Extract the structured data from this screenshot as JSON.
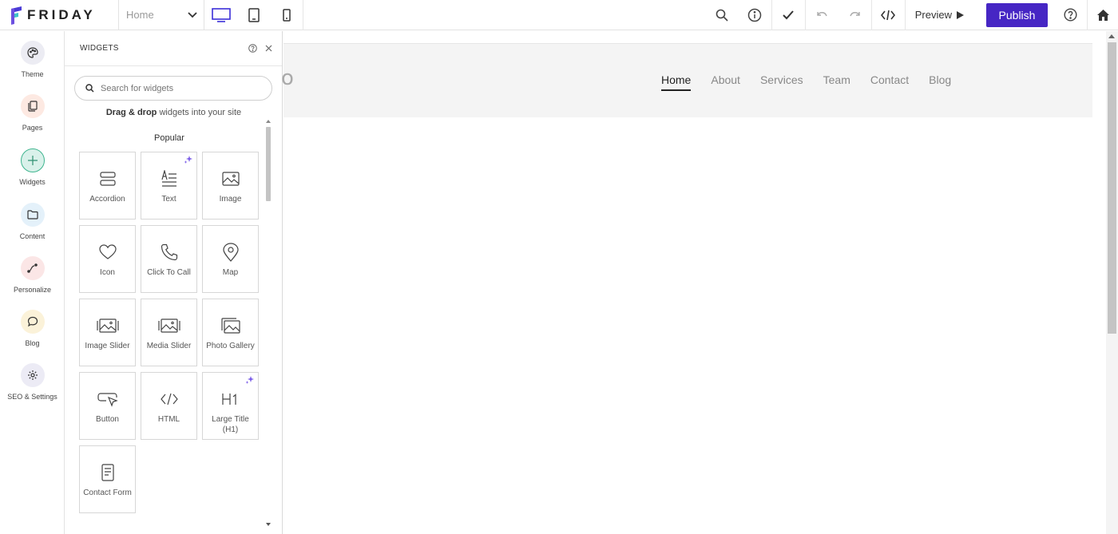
{
  "app": {
    "brand": "FRIDAY"
  },
  "topbar": {
    "page_select": "Home",
    "preview_label": "Preview",
    "publish_label": "Publish"
  },
  "rail": {
    "items": [
      {
        "label": "Theme"
      },
      {
        "label": "Pages"
      },
      {
        "label": "Widgets"
      },
      {
        "label": "Content"
      },
      {
        "label": "Personalize"
      },
      {
        "label": "Blog"
      },
      {
        "label": "SEO & Settings"
      }
    ]
  },
  "panel": {
    "title": "WIDGETS",
    "search_placeholder": "Search for widgets",
    "hint_bold": "Drag & drop",
    "hint_rest": " widgets into your site",
    "section": "Popular",
    "widgets": [
      {
        "label": "Accordion",
        "icon": "accordion-icon"
      },
      {
        "label": "Text",
        "icon": "text-icon"
      },
      {
        "label": "Image",
        "icon": "image-icon"
      },
      {
        "label": "Icon",
        "icon": "heart-icon"
      },
      {
        "label": "Click To Call",
        "icon": "phone-icon"
      },
      {
        "label": "Map",
        "icon": "map-pin-icon"
      },
      {
        "label": "Image Slider",
        "icon": "image-slider-icon"
      },
      {
        "label": "Media Slider",
        "icon": "media-slider-icon"
      },
      {
        "label": "Photo Gallery",
        "icon": "photo-gallery-icon"
      },
      {
        "label": "Button",
        "icon": "button-icon"
      },
      {
        "label": "HTML",
        "icon": "code-icon"
      },
      {
        "label": "Large Title (H1)",
        "icon": "h1-icon"
      },
      {
        "label": "Contact Form",
        "icon": "form-icon"
      }
    ]
  },
  "site": {
    "logo_fragment": "o",
    "nav": [
      "Home",
      "About",
      "Services",
      "Team",
      "Contact",
      "Blog"
    ]
  },
  "colors": {
    "accent": "#4626c4",
    "active_device": "#3b2fd9"
  }
}
